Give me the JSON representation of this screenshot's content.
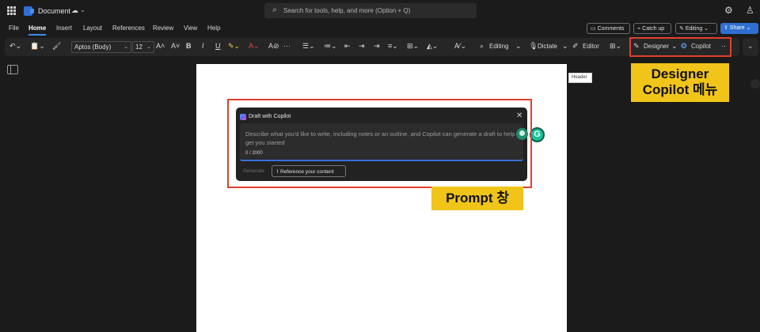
{
  "app": {
    "title": "Document",
    "search_placeholder": "Search for tools, help, and more (Option + Q)"
  },
  "menu": {
    "items": [
      "File",
      "Home",
      "Insert",
      "Layout",
      "References",
      "Review",
      "View",
      "Help"
    ],
    "active": "Home"
  },
  "actions": {
    "comments": "Comments",
    "catch_up": "Catch up",
    "editing": "Editing",
    "share": "Share"
  },
  "ribbon": {
    "font_name": "Aptos (Body)",
    "font_size": "12",
    "editing_mode": "Editing",
    "dictate": "Dictate",
    "editor": "Editor",
    "designer": "Designer",
    "copilot": "Copilot"
  },
  "tooltip": "Header",
  "copilot_dialog": {
    "title": "Draft with Copilot",
    "placeholder": "Describe what you'd like to write, including notes or an outline, and Copilot can generate a draft to help get you started",
    "counter": "0 / 2000",
    "generate": "Generate",
    "reference": "Reference your content"
  },
  "annotations": {
    "designer_line1": "Designer",
    "designer_line2": "Copilot 메뉴",
    "prompt": "Prompt 창",
    "highlight_color": "#e2402b",
    "label_color": "#f0c419"
  },
  "colors": {
    "accent": "#3b8bf2",
    "share_button": "#2f6fd1",
    "background": "#1b1b1b"
  }
}
